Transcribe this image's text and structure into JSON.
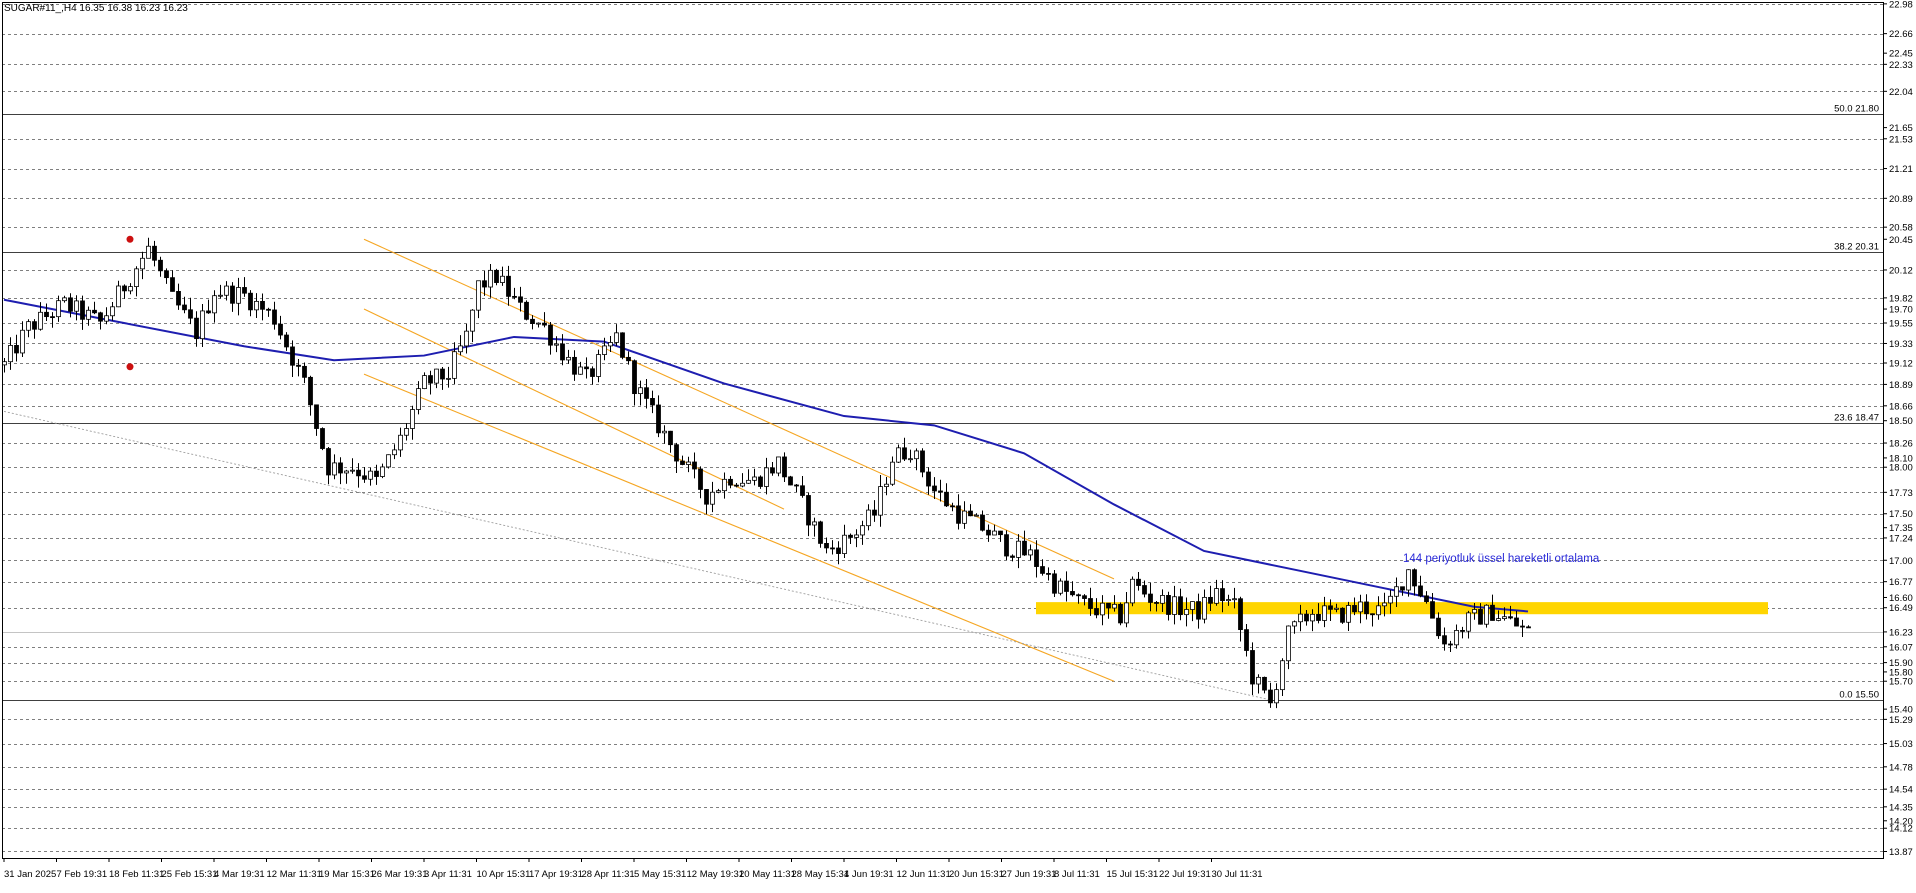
{
  "chart_data": {
    "type": "candlestick",
    "title": "SUGAR#11_,H4  16.35 16.38 16.23 16.23",
    "ylim": [
      13.8,
      23.0
    ],
    "price_axis_labels": [
      {
        "value": 22.98,
        "label": "22.98"
      },
      {
        "value": 22.66,
        "label": "22.66"
      },
      {
        "value": 22.45,
        "label": "22.45"
      },
      {
        "value": 22.33,
        "label": "22.33"
      },
      {
        "value": 22.04,
        "label": "22.04"
      },
      {
        "value": 21.65,
        "label": "21.65"
      },
      {
        "value": 21.53,
        "label": "21.53"
      },
      {
        "value": 21.21,
        "label": "21.21"
      },
      {
        "value": 20.89,
        "label": "20.89"
      },
      {
        "value": 20.58,
        "label": "20.58"
      },
      {
        "value": 20.45,
        "label": "20.45"
      },
      {
        "value": 20.12,
        "label": "20.12"
      },
      {
        "value": 19.82,
        "label": "19.82"
      },
      {
        "value": 19.7,
        "label": "19.70"
      },
      {
        "value": 19.55,
        "label": "19.55"
      },
      {
        "value": 19.33,
        "label": "19.33"
      },
      {
        "value": 19.12,
        "label": "19.12"
      },
      {
        "value": 18.89,
        "label": "18.89"
      },
      {
        "value": 18.66,
        "label": "18.66"
      },
      {
        "value": 18.5,
        "label": "18.50"
      },
      {
        "value": 18.26,
        "label": "18.26"
      },
      {
        "value": 18.1,
        "label": "18.10"
      },
      {
        "value": 18.0,
        "label": "18.00"
      },
      {
        "value": 17.73,
        "label": "17.73"
      },
      {
        "value": 17.5,
        "label": "17.50"
      },
      {
        "value": 17.35,
        "label": "17.35"
      },
      {
        "value": 17.24,
        "label": "17.24"
      },
      {
        "value": 17.0,
        "label": "17.00"
      },
      {
        "value": 16.77,
        "label": "16.77"
      },
      {
        "value": 16.6,
        "label": "16.60"
      },
      {
        "value": 16.49,
        "label": "16.49"
      },
      {
        "value": 16.23,
        "label": "16.23"
      },
      {
        "value": 16.07,
        "label": "16.07"
      },
      {
        "value": 15.9,
        "label": "15.90"
      },
      {
        "value": 15.8,
        "label": "15.80"
      },
      {
        "value": 15.7,
        "label": "15.70"
      },
      {
        "value": 15.4,
        "label": "15.40"
      },
      {
        "value": 15.29,
        "label": "15.29"
      },
      {
        "value": 15.03,
        "label": "15.03"
      },
      {
        "value": 14.78,
        "label": "14.78"
      },
      {
        "value": 14.54,
        "label": "14.54"
      },
      {
        "value": 14.35,
        "label": "14.35"
      },
      {
        "value": 14.2,
        "label": "14.20"
      },
      {
        "value": 14.12,
        "label": "14.12"
      },
      {
        "value": 13.87,
        "label": "13.87"
      }
    ],
    "dashed_levels": [
      22.98,
      22.66,
      22.33,
      22.04,
      21.53,
      21.21,
      20.89,
      20.58,
      20.12,
      19.82,
      19.55,
      19.33,
      19.12,
      18.89,
      18.66,
      18.26,
      18.0,
      17.73,
      17.5,
      17.24,
      17.0,
      16.77,
      16.49,
      16.07,
      15.9,
      15.7,
      15.29,
      15.03,
      14.78,
      14.54,
      14.35,
      14.12,
      13.87
    ],
    "fib_levels": [
      {
        "value": 21.8,
        "label": "50.0 21.80"
      },
      {
        "value": 20.31,
        "label": "38.2 20.31"
      },
      {
        "value": 18.47,
        "label": "23.6 18.47"
      },
      {
        "value": 15.5,
        "label": "0.0 15.50"
      }
    ],
    "current_price": 16.23,
    "date_labels": [
      "31 Jan 2025",
      "7 Feb 19:31",
      "18 Feb 11:31",
      "25 Feb 15:31",
      "4 Mar 19:31",
      "12 Mar 11:31",
      "19 Mar 15:31",
      "26 Mar 19:31",
      "3 Apr 11:31",
      "10 Apr 15:31",
      "17 Apr 19:31",
      "28 Apr 11:31",
      "5 May 15:31",
      "12 May 19:31",
      "20 May 11:31",
      "28 May 15:31",
      "4 Jun 19:31",
      "12 Jun 11:31",
      "20 Jun 15:31",
      "27 Jun 19:31",
      "8 Jul 11:31",
      "15 Jul 15:31",
      "22 Jul 19:31",
      "30 Jul 11:31"
    ],
    "price_path": [
      [
        0,
        19.1
      ],
      [
        4,
        19.5
      ],
      [
        10,
        19.75
      ],
      [
        16,
        19.55
      ],
      [
        20,
        19.95
      ],
      [
        24,
        20.35
      ],
      [
        28,
        19.8
      ],
      [
        32,
        19.45
      ],
      [
        35,
        19.9
      ],
      [
        40,
        19.85
      ],
      [
        45,
        19.6
      ],
      [
        50,
        18.9
      ],
      [
        54,
        18.0
      ],
      [
        58,
        18.0
      ],
      [
        62,
        17.85
      ],
      [
        66,
        18.3
      ],
      [
        70,
        18.9
      ],
      [
        74,
        19.0
      ],
      [
        77,
        19.4
      ],
      [
        79,
        19.95
      ],
      [
        82,
        20.05
      ],
      [
        86,
        19.7
      ],
      [
        90,
        19.5
      ],
      [
        94,
        19.15
      ],
      [
        97,
        18.95
      ],
      [
        100,
        19.2
      ],
      [
        102,
        19.4
      ],
      [
        105,
        18.9
      ],
      [
        109,
        18.45
      ],
      [
        113,
        18.05
      ],
      [
        117,
        17.7
      ],
      [
        121,
        17.9
      ],
      [
        125,
        17.85
      ],
      [
        129,
        18.05
      ],
      [
        133,
        17.6
      ],
      [
        137,
        17.1
      ],
      [
        141,
        17.25
      ],
      [
        145,
        17.5
      ],
      [
        148,
        18.1
      ],
      [
        151,
        18.2
      ],
      [
        155,
        17.75
      ],
      [
        159,
        17.5
      ],
      [
        163,
        17.35
      ],
      [
        167,
        17.15
      ],
      [
        171,
        17.05
      ],
      [
        175,
        16.75
      ],
      [
        179,
        16.55
      ],
      [
        183,
        16.45
      ],
      [
        186,
        16.4
      ],
      [
        188,
        16.75
      ],
      [
        191,
        16.6
      ],
      [
        195,
        16.5
      ],
      [
        199,
        16.45
      ],
      [
        202,
        16.65
      ],
      [
        205,
        16.5
      ],
      [
        208,
        15.75
      ],
      [
        211,
        15.45
      ],
      [
        214,
        16.2
      ],
      [
        218,
        16.45
      ],
      [
        222,
        16.4
      ],
      [
        226,
        16.5
      ],
      [
        230,
        16.45
      ],
      [
        234,
        16.9
      ],
      [
        237,
        16.55
      ],
      [
        240,
        16.1
      ],
      [
        244,
        16.35
      ],
      [
        248,
        16.45
      ],
      [
        252,
        16.3
      ],
      [
        254,
        16.23
      ]
    ],
    "ema": {
      "label": "144 periyotluk üssel hareketli ortalama",
      "color": "#1e1eb0",
      "path": [
        [
          0,
          19.8
        ],
        [
          20,
          19.55
        ],
        [
          40,
          19.3
        ],
        [
          55,
          19.15
        ],
        [
          70,
          19.2
        ],
        [
          85,
          19.4
        ],
        [
          100,
          19.35
        ],
        [
          120,
          18.9
        ],
        [
          140,
          18.55
        ],
        [
          155,
          18.45
        ],
        [
          170,
          18.15
        ],
        [
          185,
          17.6
        ],
        [
          200,
          17.1
        ],
        [
          215,
          16.9
        ],
        [
          230,
          16.7
        ],
        [
          245,
          16.5
        ],
        [
          254,
          16.45
        ]
      ]
    },
    "channel": {
      "color": "#f5a623",
      "upper": [
        [
          60,
          20.45
        ],
        [
          185,
          16.8
        ]
      ],
      "lower": [
        [
          60,
          19.0
        ],
        [
          185,
          15.7
        ]
      ],
      "mid": [
        [
          60,
          19.7
        ],
        [
          130,
          17.55
        ]
      ]
    },
    "lower_trendline": {
      "color": "#9e9e9e",
      "points": [
        [
          0,
          18.6
        ],
        [
          211,
          15.5
        ]
      ]
    },
    "support_zone": {
      "color": "#ffd500",
      "from_index": 172,
      "to_index": 294,
      "low": 16.42,
      "high": 16.55
    },
    "marker_color": "#cc1010",
    "markers": [
      {
        "name": "high-marker",
        "index": 21,
        "value": 20.45
      },
      {
        "name": "low-marker",
        "index": 21,
        "value": 19.08
      }
    ],
    "colors": {
      "bull": "#ffffff",
      "bear": "#000000",
      "wick": "#000000",
      "grid": "#000000"
    }
  }
}
